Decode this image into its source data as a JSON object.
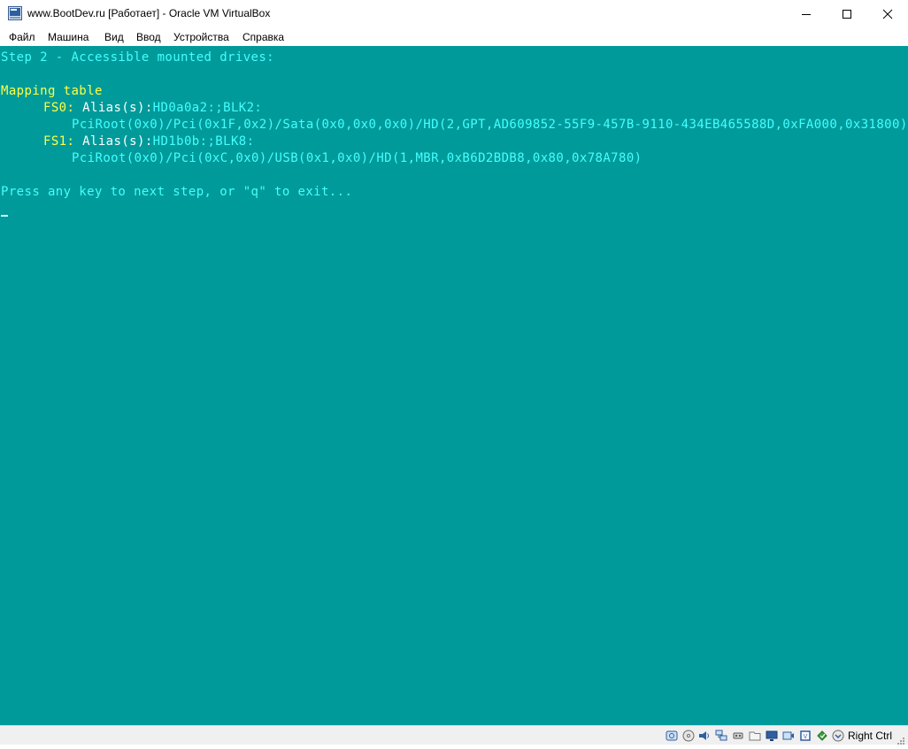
{
  "window": {
    "title": "www.BootDev.ru [Работает] - Oracle VM VirtualBox",
    "icon": "virtualbox-vm-icon"
  },
  "menu": {
    "items": [
      "Файл",
      "Машина",
      "Вид",
      "Ввод",
      "Устройства",
      "Справка"
    ]
  },
  "console": {
    "step_heading": "Step 2 - Accessible mounted drives:",
    "mapping_heading": "Mapping table",
    "entries": [
      {
        "fs": "FS0",
        "alias_label": "Alias(s)",
        "alias_value": "HD0a0a2:;BLK2:",
        "path": "PciRoot(0x0)/Pci(0x1F,0x2)/Sata(0x0,0x0,0x0)/HD(2,GPT,AD609852-55F9-457B-9110-434EB465588D,0xFA000,0x31800)"
      },
      {
        "fs": "FS1",
        "alias_label": "Alias(s)",
        "alias_value": "HD1b0b:;BLK8:",
        "path": "PciRoot(0x0)/Pci(0xC,0x0)/USB(0x1,0x0)/HD(1,MBR,0xB6D2BDB8,0x80,0x78A780)"
      }
    ],
    "prompt": "Press any key to next step, or \"q\" to exit..."
  },
  "statusbar": {
    "host_key": "Right Ctrl",
    "icons": [
      "hard-disk-icon",
      "optical-drive-icon",
      "audio-icon",
      "network-icon",
      "usb-icon",
      "shared-folders-icon",
      "display-icon",
      "video-capture-icon",
      "cpu-icon",
      "mouse-integration-icon",
      "arrow-down-icon"
    ]
  },
  "colors": {
    "screen_bg": "#009a9a",
    "console_cyan": "#44ffff",
    "console_yellow": "#ffff44",
    "console_white": "#ffffff"
  }
}
